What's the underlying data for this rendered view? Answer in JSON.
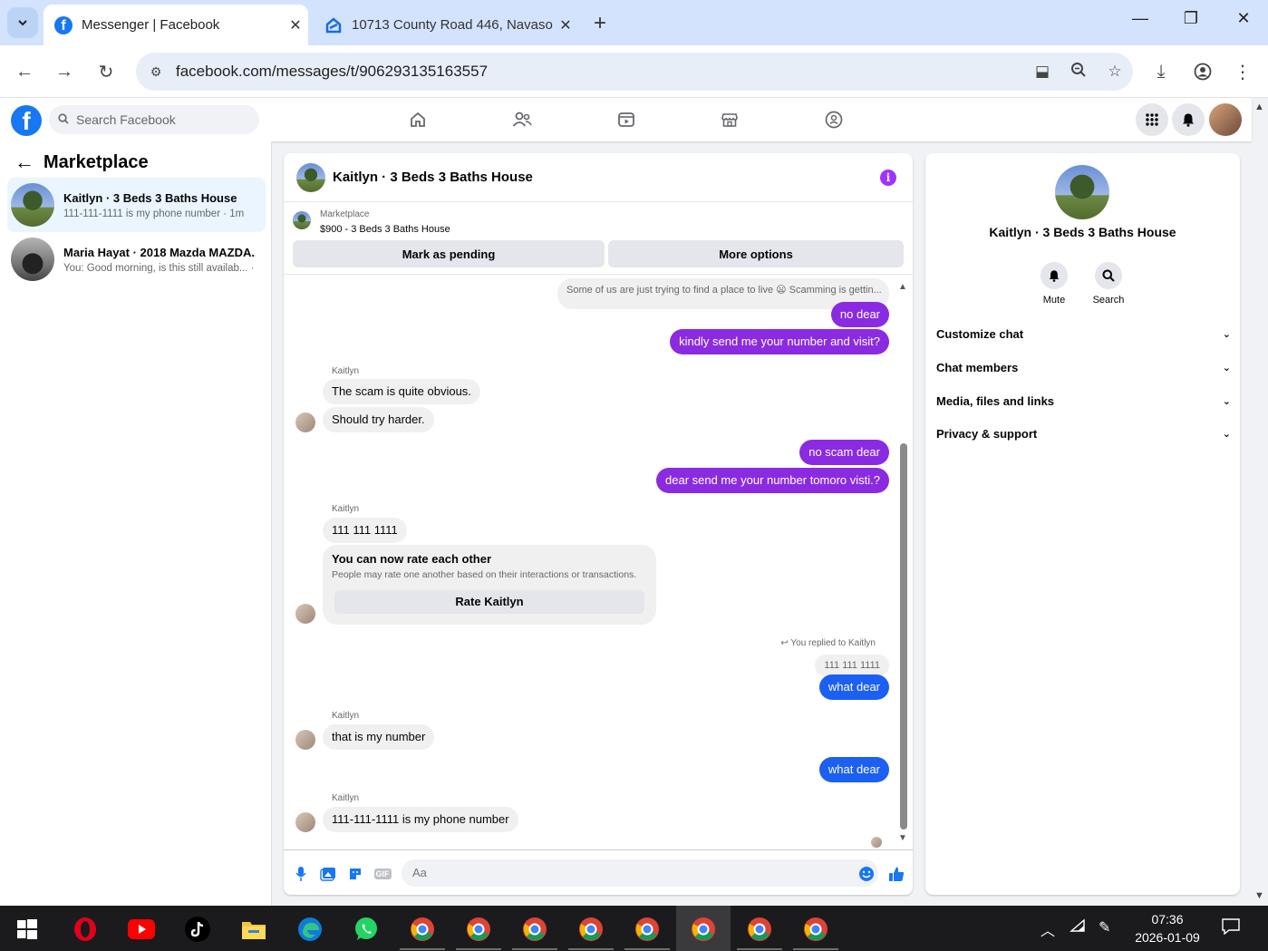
{
  "browser": {
    "tabs": [
      {
        "title": "Messenger | Facebook",
        "active": true,
        "favicon": "facebook-icon"
      },
      {
        "title": "10713 County Road 446, Navaso",
        "active": false,
        "favicon": "zillow-icon"
      }
    ],
    "url": "facebook.com/messages/t/906293135163557"
  },
  "fb": {
    "search_placeholder": "Search Facebook",
    "nav_icons": [
      "home-icon",
      "friends-icon",
      "watch-icon",
      "marketplace-icon",
      "groups-icon"
    ],
    "right_icons": [
      "menu-grid-icon",
      "notifications-icon",
      "profile-avatar"
    ]
  },
  "sidebar": {
    "title": "Marketplace",
    "conversations": [
      {
        "name": "Kaitlyn · 3 Beds 3 Baths House",
        "preview": "111-111-1111 is my phone number · 1m",
        "active": true
      },
      {
        "name": "Maria Hayat · 2018 Mazda MAZDA...",
        "preview": "You: Good morning, is this still availab... · 1d",
        "active": false
      }
    ]
  },
  "chat": {
    "header_name": "Kaitlyn · 3 Beds 3 Baths House",
    "marketplace_label": "Marketplace",
    "listing": "$900 - 3 Beds 3 Baths House",
    "mark_pending": "Mark as pending",
    "more_options": "More options",
    "messages": {
      "m0": "Some of us are just trying to find a place to live 😦 Scamming is gettin...",
      "m1": "no dear",
      "m2": "kindly send me your number and visit?",
      "sender": "Kaitlyn",
      "m3": "The scam is quite obvious.",
      "m4": "Should try harder.",
      "m5": "no scam dear",
      "m6": "dear send me your number tomoro visti.?",
      "m7": "111 111 1111",
      "rate_title": "You can now rate each other",
      "rate_sub": "People may rate one another based on their interactions or transactions.",
      "rate_btn": "Rate Kaitlyn",
      "reply_note": "You replied to Kaitlyn",
      "quoted": "111 111 1111",
      "m8": "what dear",
      "m9": "that is my number",
      "m10": "what dear",
      "m11": "111-111-1111 is my phone number"
    },
    "composer_placeholder": "Aa"
  },
  "right_panel": {
    "name": "Kaitlyn · 3 Beds 3 Baths House",
    "mute": "Mute",
    "search": "Search",
    "sections": [
      "Customize chat",
      "Chat members",
      "Media, files and links",
      "Privacy & support"
    ]
  },
  "taskbar": {
    "time": "07:36",
    "date": "2026-01-09"
  },
  "colors": {
    "fb_blue": "#1877f2",
    "outgoing_purple": "#8a2be2",
    "outgoing_blue": "#1c5ff3",
    "incoming_gray": "#f0f0f0"
  }
}
